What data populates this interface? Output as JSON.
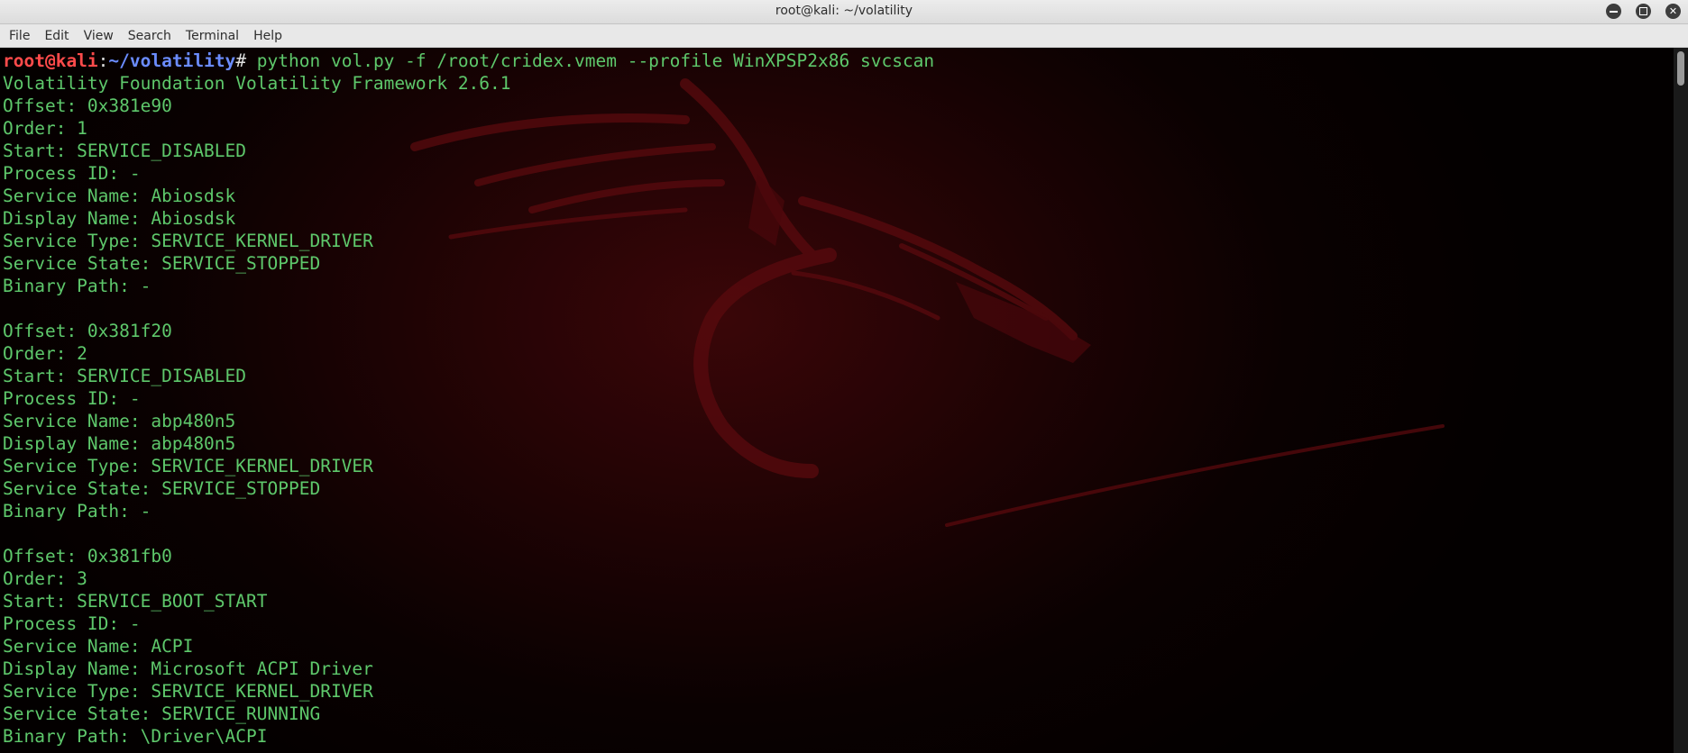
{
  "window": {
    "title": "root@kali: ~/volatility"
  },
  "menu": [
    "File",
    "Edit",
    "View",
    "Search",
    "Terminal",
    "Help"
  ],
  "prompt": {
    "user_host": "root@kali",
    "colon": ":",
    "path": "~/volatility",
    "symbol": "#",
    "command": " python vol.py -f /root/cridex.vmem --profile WinXPSP2x86 svcscan"
  },
  "output": [
    "Volatility Foundation Volatility Framework 2.6.1",
    "Offset: 0x381e90",
    "Order: 1",
    "Start: SERVICE_DISABLED",
    "Process ID: -",
    "Service Name: Abiosdsk",
    "Display Name: Abiosdsk",
    "Service Type: SERVICE_KERNEL_DRIVER",
    "Service State: SERVICE_STOPPED",
    "Binary Path: -",
    "",
    "Offset: 0x381f20",
    "Order: 2",
    "Start: SERVICE_DISABLED",
    "Process ID: -",
    "Service Name: abp480n5",
    "Display Name: abp480n5",
    "Service Type: SERVICE_KERNEL_DRIVER",
    "Service State: SERVICE_STOPPED",
    "Binary Path: -",
    "",
    "Offset: 0x381fb0",
    "Order: 3",
    "Start: SERVICE_BOOT_START",
    "Process ID: -",
    "Service Name: ACPI",
    "Display Name: Microsoft ACPI Driver",
    "Service Type: SERVICE_KERNEL_DRIVER",
    "Service State: SERVICE_RUNNING",
    "Binary Path: \\Driver\\ACPI"
  ],
  "icons": {
    "minimize": "minimize-icon",
    "maximize": "maximize-icon",
    "close": "close-icon"
  },
  "colors": {
    "terminal_text": "#5ec86b",
    "prompt_user": "#ff4b4b",
    "prompt_path": "#6b8cff",
    "background": "#1e0304"
  }
}
